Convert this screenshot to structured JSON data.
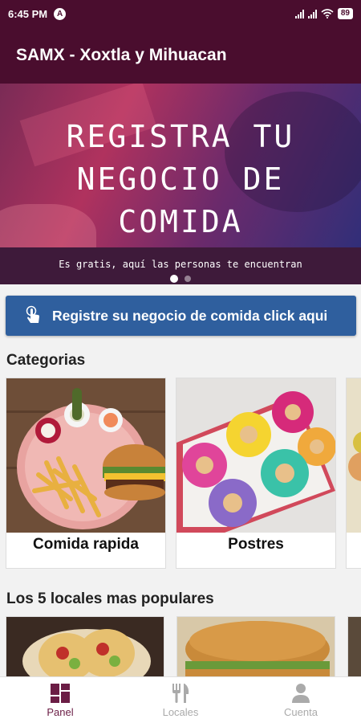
{
  "status_bar": {
    "time": "6:45 PM",
    "badge": "A",
    "battery": "89"
  },
  "app_bar": {
    "title": "SAMX - Xoxtla y Mihuacan"
  },
  "banner": {
    "lines": [
      "REGISTRA TU",
      "NEGOCIO DE",
      "COMIDA"
    ],
    "subtitle": "Es gratis, aquí las personas te encuentran",
    "active_dot": 1,
    "dot_count": 2
  },
  "cta": {
    "label": "Registre su negocio de comida click aqui",
    "icon": "hand-pointer-icon"
  },
  "categories": {
    "title": "Categorias",
    "items": [
      {
        "label": "Comida rapida",
        "image": "burger-fries"
      },
      {
        "label": "Postres",
        "image": "donuts"
      }
    ]
  },
  "popular": {
    "title": "Los 5 locales mas populares"
  },
  "bottom_nav": {
    "items": [
      {
        "label": "Panel",
        "icon": "dashboard-icon",
        "active": true
      },
      {
        "label": "Locales",
        "icon": "fork-knife-icon",
        "active": false
      },
      {
        "label": "Cuenta",
        "icon": "person-icon",
        "active": false
      }
    ]
  },
  "colors": {
    "primary": "#4a0d2e",
    "cta": "#2f5f9e",
    "active_nav": "#6b1d45"
  }
}
